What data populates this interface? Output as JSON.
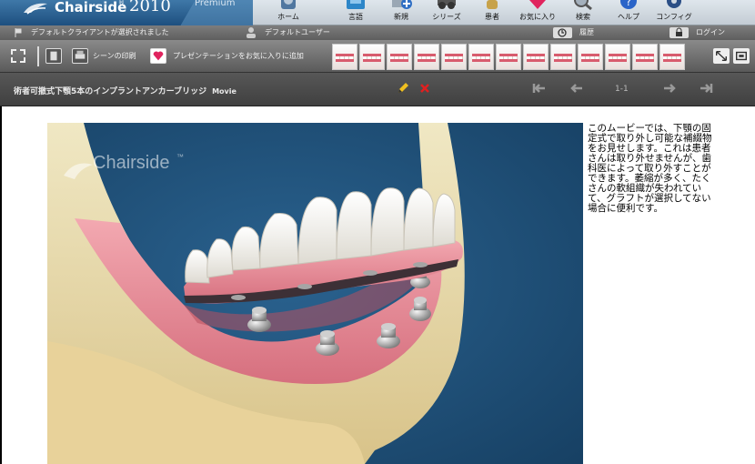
{
  "brand": {
    "name": "Chairside",
    "trademark": "®",
    "year": "2010",
    "edition": "Premium"
  },
  "nav": [
    {
      "label": "ホーム",
      "icon": "home-icon"
    },
    {
      "label": "言語",
      "icon": "language-icon"
    },
    {
      "label": "新規",
      "icon": "new-icon"
    },
    {
      "label": "シリーズ",
      "icon": "series-icon"
    },
    {
      "label": "患者",
      "icon": "patient-icon"
    },
    {
      "label": "お気に入り",
      "icon": "favorites-icon"
    },
    {
      "label": "検索",
      "icon": "search-icon"
    },
    {
      "label": "ヘルプ",
      "icon": "help-icon"
    },
    {
      "label": "コンフィグ",
      "icon": "config-icon"
    }
  ],
  "status": {
    "client": "デフォルトクライアントが選択されました",
    "user": "デフォルトユーザー",
    "history": "履歴",
    "login": "ログイン"
  },
  "toolbar": {
    "print": "シーンの印刷",
    "favorite": "プレゼンテーションをお気に入りに追加",
    "thumb_count": 13
  },
  "movie": {
    "title": "術者可撤式下顎5本のインプラントアンカーブリッジ",
    "type": "Movie",
    "page": "1-1",
    "watermark": "Chairside",
    "watermark_tm": "™",
    "description": "このムービーでは、下顎の固定式で取り外し可能な補綴物をお見せします。これは患者さんは取り外せませんが、歯科医によって取り外すことができます。萎縮が多く、たくさんの軟組織が失われていて、グラフトが選択してない場合に便利です。"
  },
  "colors": {
    "brand_blue": "#1d4f7f",
    "viewer_bg": "#1b4d76",
    "gum": "#e88b96",
    "bone": "#ecd8a2",
    "edit_pencil": "#f0c020",
    "delete_x": "#e02020"
  }
}
